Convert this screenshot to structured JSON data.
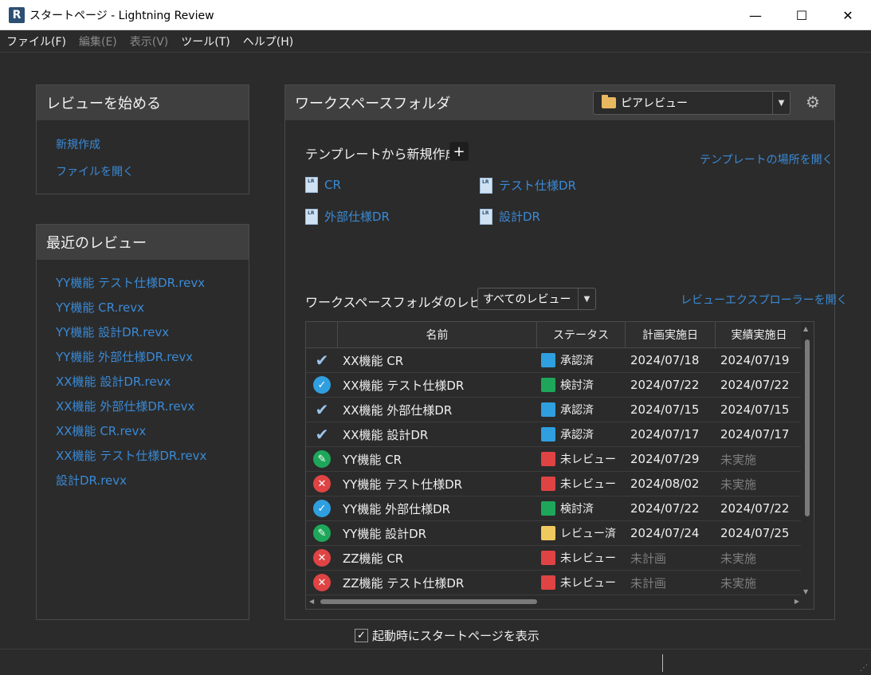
{
  "window": {
    "app_icon": "R",
    "title": "スタートページ - Lightning Review",
    "minimize": "—",
    "maximize": "☐",
    "close": "✕"
  },
  "menu": [
    {
      "label": "ファイル(F)",
      "enabled": true
    },
    {
      "label": "編集(E)",
      "enabled": false
    },
    {
      "label": "表示(V)",
      "enabled": false
    },
    {
      "label": "ツール(T)",
      "enabled": true
    },
    {
      "label": "ヘルプ(H)",
      "enabled": true
    }
  ],
  "start_panel": {
    "title": "レビューを始める",
    "new_link": "新規作成",
    "open_link": "ファイルを開く"
  },
  "recent_panel": {
    "title": "最近のレビュー",
    "items": [
      "YY機能 テスト仕様DR.revx",
      "YY機能 CR.revx",
      "YY機能 設計DR.revx",
      "YY機能 外部仕様DR.revx",
      "XX機能 設計DR.revx",
      "XX機能 外部仕様DR.revx",
      "XX機能 CR.revx",
      "XX機能 テスト仕様DR.revx",
      "設計DR.revx"
    ]
  },
  "workspace": {
    "title": "ワークスペースフォルダ",
    "folder_selected": "ピアレビュー",
    "template_heading": "テンプレートから新規作成",
    "add_label": "+",
    "open_template_location": "テンプレートの場所を開く",
    "templates": [
      "CR",
      "テスト仕様DR",
      "外部仕様DR",
      "設計DR"
    ],
    "reviews_heading": "ワークスペースフォルダのレビュー",
    "filter_selected": "すべてのレビュー",
    "open_explorer": "レビューエクスプローラーを開く"
  },
  "table": {
    "columns": [
      "",
      "名前",
      "ステータス",
      "計画実施日",
      "実績実施日"
    ],
    "rows": [
      {
        "icon": "approved-check",
        "name": "XX機能 CR",
        "status": "承認済",
        "status_color": "#2f9fe0",
        "planned": "2024/07/18",
        "actual": "2024/07/19",
        "planned_dim": false,
        "actual_dim": false
      },
      {
        "icon": "reviewed-circle",
        "name": "XX機能 テスト仕様DR",
        "status": "検討済",
        "status_color": "#1ea75a",
        "planned": "2024/07/22",
        "actual": "2024/07/22",
        "planned_dim": false,
        "actual_dim": false
      },
      {
        "icon": "approved-check",
        "name": "XX機能 外部仕様DR",
        "status": "承認済",
        "status_color": "#2f9fe0",
        "planned": "2024/07/15",
        "actual": "2024/07/15",
        "planned_dim": false,
        "actual_dim": false
      },
      {
        "icon": "approved-check",
        "name": "XX機能 設計DR",
        "status": "承認済",
        "status_color": "#2f9fe0",
        "planned": "2024/07/17",
        "actual": "2024/07/17",
        "planned_dim": false,
        "actual_dim": false
      },
      {
        "icon": "edit-circle",
        "name": "YY機能 CR",
        "status": "未レビュー",
        "status_color": "#e04343",
        "planned": "2024/07/29",
        "actual": "未実施",
        "planned_dim": false,
        "actual_dim": true
      },
      {
        "icon": "error-circle",
        "name": "YY機能 テスト仕様DR",
        "status": "未レビュー",
        "status_color": "#e04343",
        "planned": "2024/08/02",
        "actual": "未実施",
        "planned_dim": false,
        "actual_dim": true
      },
      {
        "icon": "reviewed-circle",
        "name": "YY機能 外部仕様DR",
        "status": "検討済",
        "status_color": "#1ea75a",
        "planned": "2024/07/22",
        "actual": "2024/07/22",
        "planned_dim": false,
        "actual_dim": false
      },
      {
        "icon": "edit-circle",
        "name": "YY機能 設計DR",
        "status": "レビュー済",
        "status_color": "#f0c860",
        "planned": "2024/07/24",
        "actual": "2024/07/25",
        "planned_dim": false,
        "actual_dim": false
      },
      {
        "icon": "error-circle",
        "name": "ZZ機能 CR",
        "status": "未レビュー",
        "status_color": "#e04343",
        "planned": "未計画",
        "actual": "未実施",
        "planned_dim": true,
        "actual_dim": true
      },
      {
        "icon": "error-circle",
        "name": "ZZ機能 テスト仕様DR",
        "status": "未レビュー",
        "status_color": "#e04343",
        "planned": "未計画",
        "actual": "未実施",
        "planned_dim": true,
        "actual_dim": true
      }
    ]
  },
  "footer": {
    "show_on_startup": "起動時にスタートページを表示",
    "checked": true
  }
}
